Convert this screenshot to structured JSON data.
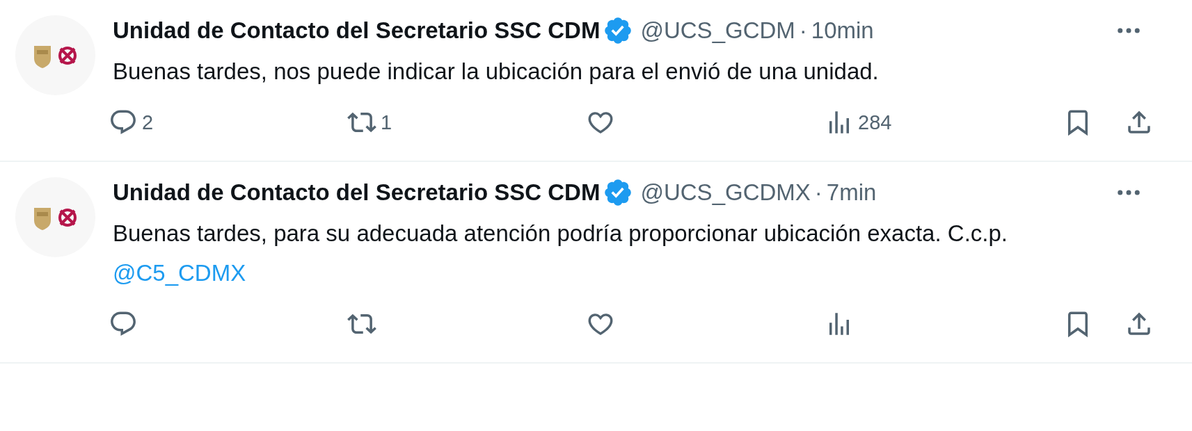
{
  "tweets": [
    {
      "name": "Unidad de Contacto del Secretario SSC CDM",
      "verified": true,
      "handle": "@UCS_GCDM",
      "dot": "·",
      "time": "10min",
      "text": "Buenas tardes, nos puede indicar la ubicación para el envió de una unidad.",
      "replies": "2",
      "reposts": "1",
      "views": "284"
    },
    {
      "name": "Unidad de Contacto del Secretario SSC CDM",
      "verified": true,
      "handle": "@UCS_GCDMX",
      "dot": "·",
      "time": "7min",
      "text": "Buenas tardes, para su adecuada atención podría proporcionar ubicación exacta. C.c.p.",
      "mention": "@C5_CDMX"
    }
  ]
}
